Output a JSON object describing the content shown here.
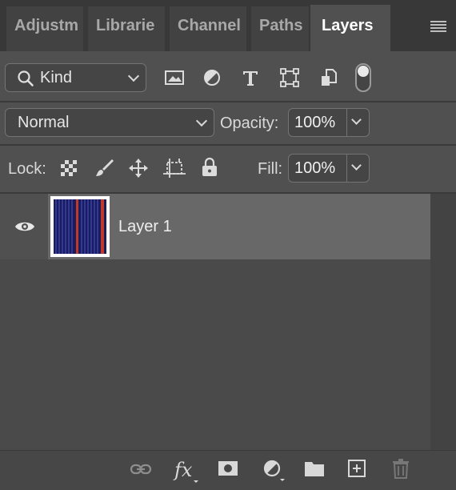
{
  "tabs": [
    {
      "label": "Adjustm",
      "active": false
    },
    {
      "label": "Librarie",
      "active": false
    },
    {
      "label": "Channel",
      "active": false
    },
    {
      "label": "Paths",
      "active": false
    },
    {
      "label": "Layers",
      "active": true
    }
  ],
  "filter": {
    "kind_label": "Kind",
    "icons": [
      "image-filter-icon",
      "adjustment-filter-icon",
      "type-filter-icon",
      "shape-filter-icon",
      "smart-object-filter-icon",
      "filter-toggle-icon"
    ]
  },
  "blend": {
    "mode": "Normal",
    "opacity_label": "Opacity:",
    "opacity_value": "100%"
  },
  "lock": {
    "label": "Lock:",
    "icons": [
      "lock-transparent-pixels-icon",
      "lock-image-pixels-icon",
      "lock-position-icon",
      "lock-artboard-icon",
      "lock-all-icon"
    ],
    "fill_label": "Fill:",
    "fill_value": "100%"
  },
  "layers": [
    {
      "name": "Layer 1",
      "visible": true,
      "selected": true
    }
  ],
  "bottom_icons": [
    "link-layers-icon",
    "layer-style-fx-icon",
    "add-mask-icon",
    "adjustment-layer-icon",
    "new-group-icon",
    "new-layer-icon",
    "delete-layer-icon"
  ],
  "colors": {
    "panel_bg": "#505050",
    "selected_layer": "#686868",
    "thumbnail_blue": "#1b1d5a",
    "thumbnail_red": "#c0392b"
  }
}
